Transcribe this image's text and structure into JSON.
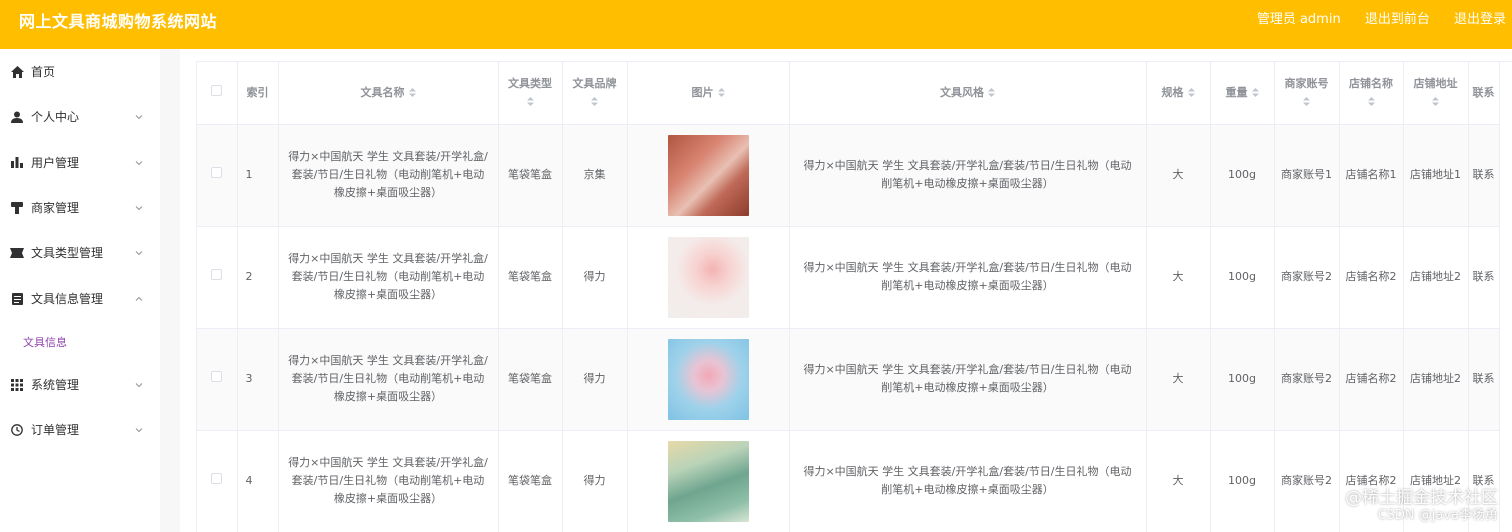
{
  "header": {
    "title": "网上文具商城购物系统网站",
    "admin": "管理员 admin",
    "back": "退出到前台",
    "logout": "退出登录"
  },
  "sidebar": {
    "items": [
      {
        "label": "首页",
        "icon": "home-icon"
      },
      {
        "label": "个人中心",
        "icon": "user-icon"
      },
      {
        "label": "用户管理",
        "icon": "chart-icon"
      },
      {
        "label": "商家管理",
        "icon": "shop-icon"
      },
      {
        "label": "文具类型管理",
        "icon": "ticket-icon"
      },
      {
        "label": "文具信息管理",
        "icon": "document-icon"
      },
      {
        "label": "系统管理",
        "icon": "grid-icon"
      },
      {
        "label": "订单管理",
        "icon": "clock-icon"
      }
    ],
    "sub_item": "文具信息"
  },
  "table": {
    "headers": [
      "索引",
      "文具名称",
      "文具类型",
      "文具品牌",
      "图片",
      "文具风格",
      "规格",
      "重量",
      "商家账号",
      "店铺名称",
      "店铺地址",
      "联系"
    ],
    "rows": [
      {
        "index": "1",
        "name": "得力×中国航天 学生 文具套装/开学礼盒/套装/节日/生日礼物（电动削笔机+电动橡皮擦+桌面吸尘器）",
        "type": "笔袋笔盒",
        "brand": "京集",
        "style": "得力×中国航天 学生 文具套装/开学礼盒/套装/节日/生日礼物（电动削笔机+电动橡皮擦+桌面吸尘器）",
        "spec": "大",
        "weight": "100g",
        "account": "商家账号1",
        "shop": "店铺名称1",
        "addr": "店铺地址1",
        "contact": "联系"
      },
      {
        "index": "2",
        "name": "得力×中国航天 学生 文具套装/开学礼盒/套装/节日/生日礼物（电动削笔机+电动橡皮擦+桌面吸尘器）",
        "type": "笔袋笔盒",
        "brand": "得力",
        "style": "得力×中国航天 学生 文具套装/开学礼盒/套装/节日/生日礼物（电动削笔机+电动橡皮擦+桌面吸尘器）",
        "spec": "大",
        "weight": "100g",
        "account": "商家账号2",
        "shop": "店铺名称2",
        "addr": "店铺地址2",
        "contact": "联系"
      },
      {
        "index": "3",
        "name": "得力×中国航天 学生 文具套装/开学礼盒/套装/节日/生日礼物（电动削笔机+电动橡皮擦+桌面吸尘器）",
        "type": "笔袋笔盒",
        "brand": "得力",
        "style": "得力×中国航天 学生 文具套装/开学礼盒/套装/节日/生日礼物（电动削笔机+电动橡皮擦+桌面吸尘器）",
        "spec": "大",
        "weight": "100g",
        "account": "商家账号2",
        "shop": "店铺名称2",
        "addr": "店铺地址2",
        "contact": "联系"
      },
      {
        "index": "4",
        "name": "得力×中国航天 学生 文具套装/开学礼盒/套装/节日/生日礼物（电动削笔机+电动橡皮擦+桌面吸尘器）",
        "type": "笔袋笔盒",
        "brand": "得力",
        "style": "得力×中国航天 学生 文具套装/开学礼盒/套装/节日/生日礼物（电动削笔机+电动橡皮擦+桌面吸尘器）",
        "spec": "大",
        "weight": "100g",
        "account": "商家账号2",
        "shop": "店铺名称2",
        "addr": "店铺地址2",
        "contact": "联系"
      }
    ]
  },
  "watermark": {
    "line1": "@稀土掘金技术社区",
    "line2": "CSDN @java李杨勇"
  },
  "colors": {
    "header_bg": "#ffbe00",
    "sub_item": "#8e44ad"
  }
}
